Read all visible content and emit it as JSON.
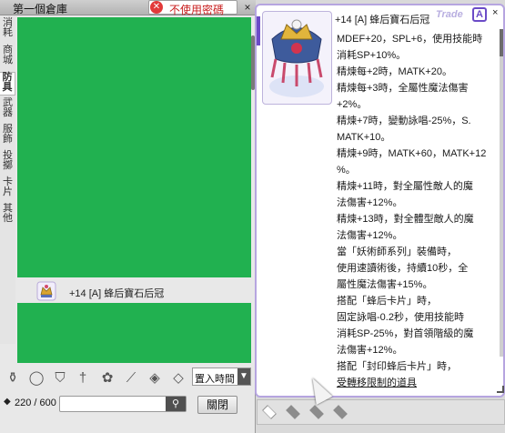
{
  "storage": {
    "title": "第一個倉庫",
    "password_button": "不使用密碼",
    "close_x": "×",
    "tabs": [
      "消耗",
      "商城",
      "防具",
      "武器",
      "服飾",
      "投擲",
      "卡片",
      "其他"
    ],
    "active_tab": "防具",
    "items": [
      {
        "name": "+14 [A] 蜂后寶石后冠",
        "icon": "crown-icon"
      }
    ],
    "filter_icons": [
      "potion-icon",
      "ring-icon",
      "armor-icon",
      "weapon-icon",
      "costume-icon",
      "wand-icon",
      "card-icon",
      "shield-icon"
    ],
    "sort_value": "置入時間",
    "capacity": "220 / 600",
    "search_placeholder": "",
    "close_button": "關閉"
  },
  "tooltip": {
    "item_name": "+14 [A] 蜂后寶石后冠",
    "trade_label": "Trade",
    "grade_badge": "A",
    "close_x": "×",
    "description_lines": [
      "MDEF+20，SPL+6，使用技能時",
      "消耗SP+10%。",
      "精煉每+2時，MATK+20。",
      "精煉每+3時，全屬性魔法傷害",
      "+2%。",
      "精煉+7時，變動詠唱-25%，S.",
      "MATK+10。",
      "精煉+9時，MATK+60，MATK+12",
      "%。",
      "精煉+11時，對全屬性敵人的魔",
      "法傷害+12%。",
      "精煉+13時，對全體型敵人的魔",
      "法傷害+12%。",
      "當「妖術師系列」裝備時，",
      "使用速讀術後，持續10秒，全",
      "屬性魔法傷害+15%。",
      "搭配「蜂后卡片」時，",
      "固定詠唱-0.2秒，使用技能時",
      "消耗SP-25%，對首領階級的魔",
      "法傷害+12%。",
      "搭配「封印蜂后卡片」時，",
      "受轉移限制的道具"
    ],
    "card_slots": 4
  }
}
